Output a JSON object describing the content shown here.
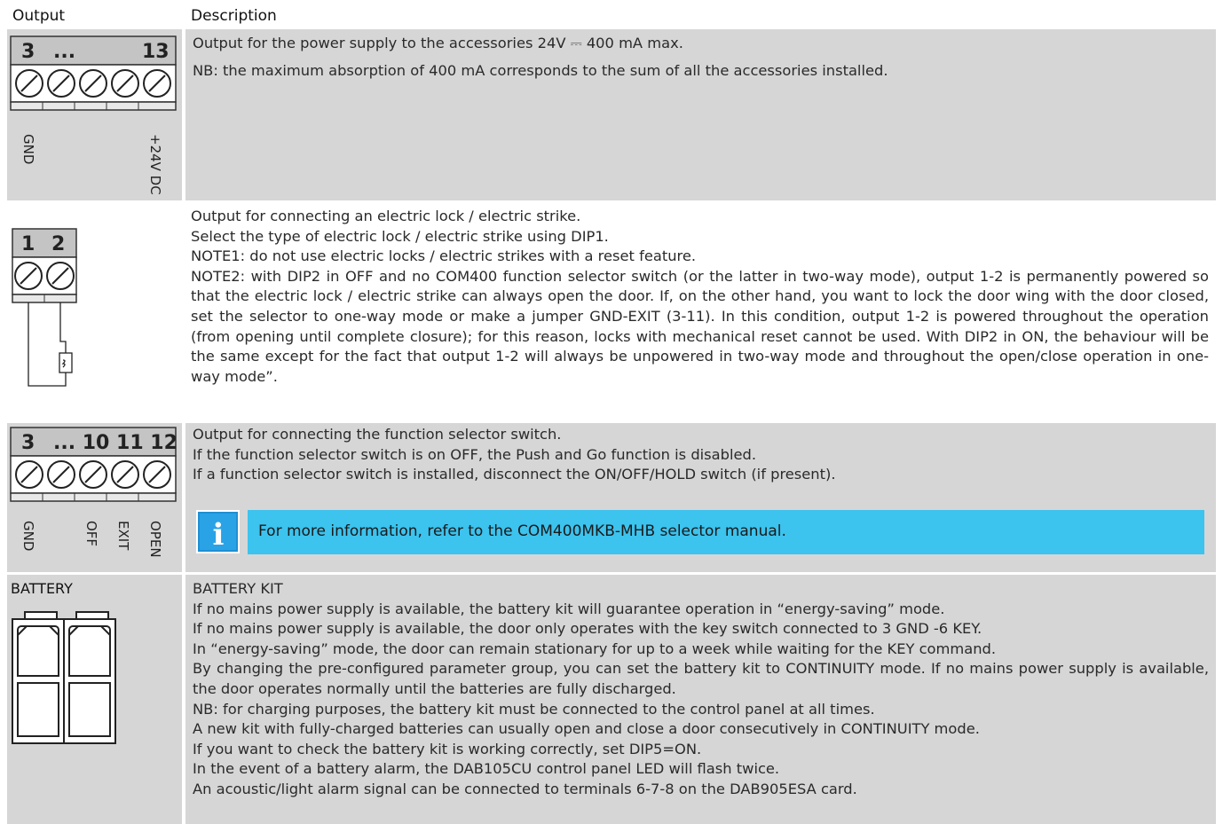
{
  "header": {
    "output": "Output",
    "description": "Description"
  },
  "rows": [
    {
      "terminal": {
        "left": "3",
        "mid": "...",
        "right": "13",
        "labels": [
          "GND",
          "+24V DC"
        ]
      },
      "lines": [
        "Output for the power supply to the accessories 24V ⎓ 400 mA max.",
        "NB: the maximum absorption of 400 mA corresponds to the sum of all the accessories installed."
      ]
    },
    {
      "terminal": {
        "left": "1",
        "right": "2"
      },
      "lines": [
        "Output for connecting an electric lock / electric strike.",
        "Select the type of electric lock / electric strike using DIP1.",
        "NOTE1: do not use electric locks / electric strikes with a reset feature."
      ],
      "paragraph": "NOTE2: with DIP2 in OFF and no COM400 function selector switch (or the latter in two-way mode), output 1-2 is permanently powered so that the electric lock / electric strike can always open the door. If, on the other hand, you want to lock the door wing with the door closed, set the selector to one-way mode or make a jumper GND-EXIT (3-11). In this condition, output 1-2 is powered throughout the operation (from opening until complete closure); for this reason, locks with mechanical reset cannot be used. With DIP2 in ON, the behaviour will be the same except for the fact that output 1-2 will always be unpowered in two-way mode and throughout the open/close operation in one-way mode”."
    },
    {
      "terminal": {
        "left": "3",
        "mid": "... 10 11 12",
        "labels": [
          "GND",
          "OFF",
          "EXIT",
          "OPEN"
        ]
      },
      "lines": [
        "Output for connecting the function selector switch.",
        "If the function selector switch is on OFF, the Push and Go function is disabled.",
        "If a function selector switch is installed, disconnect the ON/OFF/HOLD switch (if present)."
      ],
      "info": {
        "icon": "info-icon",
        "text": "For more information, refer to the COM400MKB-MHB selector manual.",
        "color": "#3cc3ee"
      }
    },
    {
      "label": "BATTERY",
      "lines": [
        "BATTERY KIT",
        "If no mains power supply is available, the battery kit will guarantee operation in “energy-saving” mode.",
        "If no mains power supply is available, the door only operates with the key switch connected to 3 GND -6 KEY.",
        "In “energy-saving” mode, the door can remain stationary for up to a week while waiting for the KEY command."
      ],
      "paragraph": "By changing the pre-configured parameter group, you can set the battery kit to CONTINUITY mode. If no mains power supply is available, the door operates normally until the batteries are fully discharged.",
      "lines2": [
        "NB: for charging purposes, the battery kit must be connected to the control panel at all times.",
        "A new kit with fully-charged batteries can usually open and close a door consecutively in CONTINUITY mode.",
        "If you want to check the battery kit is working correctly, set DIP5=ON.",
        "In the event of a battery alarm, the DAB105CU control panel LED will flash twice.",
        "An acoustic/light alarm signal can be connected to terminals 6-7-8 on the DAB905ESA card."
      ]
    }
  ]
}
